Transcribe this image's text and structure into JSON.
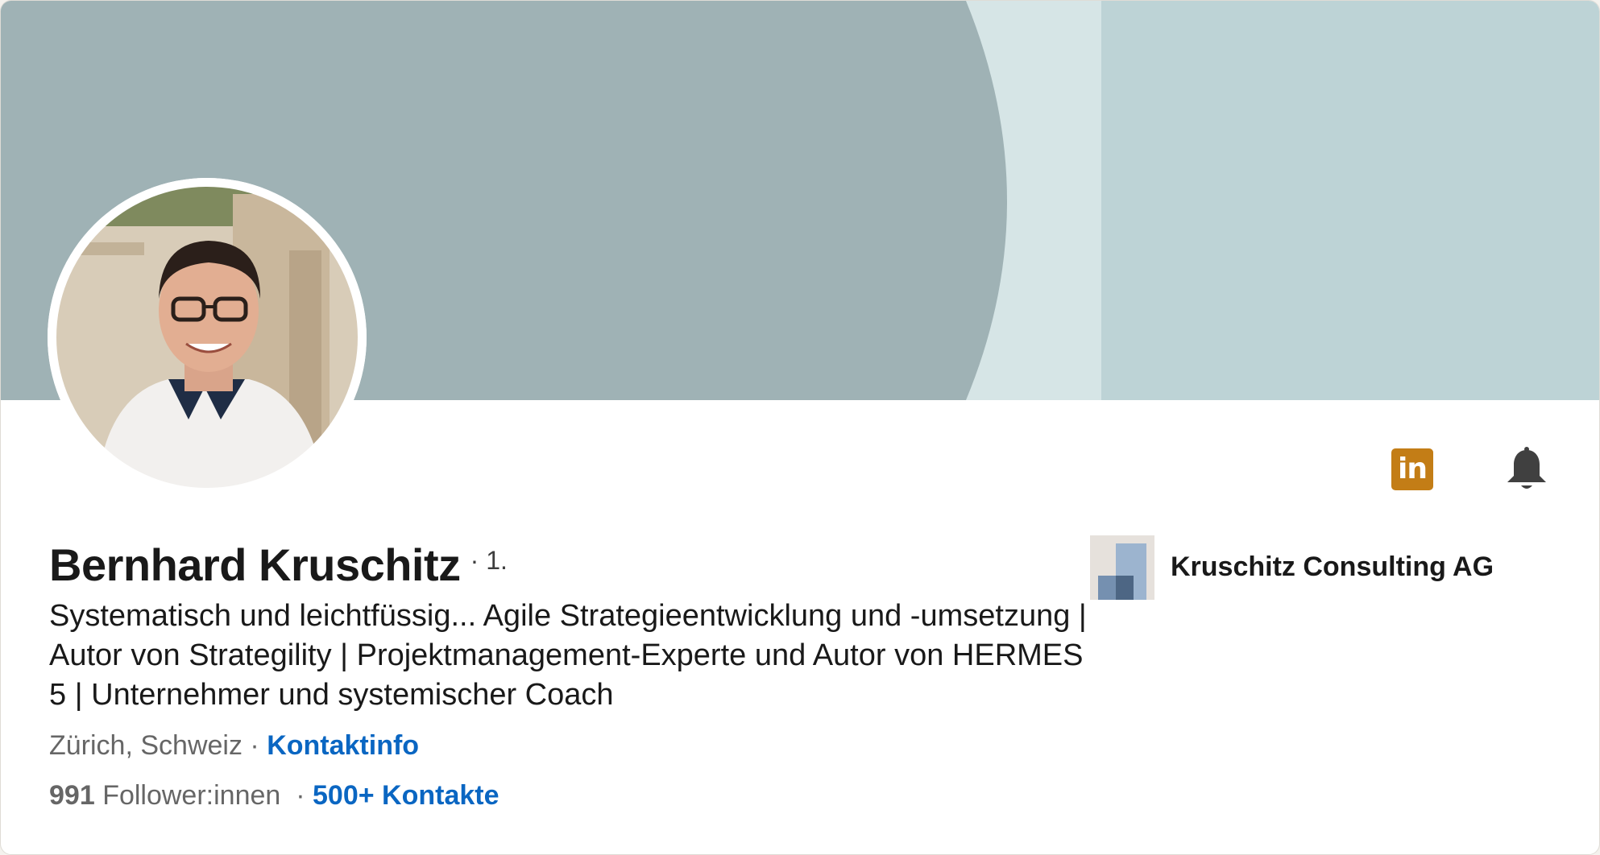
{
  "profile": {
    "name": "Bernhard Kruschitz",
    "degree": "· 1.",
    "headline": "Systematisch und leichtfüssig... Agile Strategieentwicklung und -umsetzung | Autor von Strategility | Projektmanagement-Experte und Autor von HERMES 5 | Unternehmer und systemischer Coach",
    "location": "Zürich, Schweiz",
    "location_separator": "·",
    "contact_info_label": "Kontaktinfo",
    "followers_count": "991",
    "followers_label": "Follower:innen",
    "stats_separator": "·",
    "connections_label": "500+ Kontakte"
  },
  "actions": {
    "linkedin_icon_text": "in",
    "linkedin_icon": "linkedin-icon",
    "bell_icon": "bell-icon"
  },
  "company": {
    "name": "Kruschitz Consulting AG",
    "logo_icon": "company-logo"
  },
  "colors": {
    "banner_dark": "#9fb2b5",
    "banner_light": "#d6e5e6",
    "banner_right": "#bdd3d6",
    "link_blue": "#0a66c2",
    "linkedin_orange": "#c37d16"
  }
}
